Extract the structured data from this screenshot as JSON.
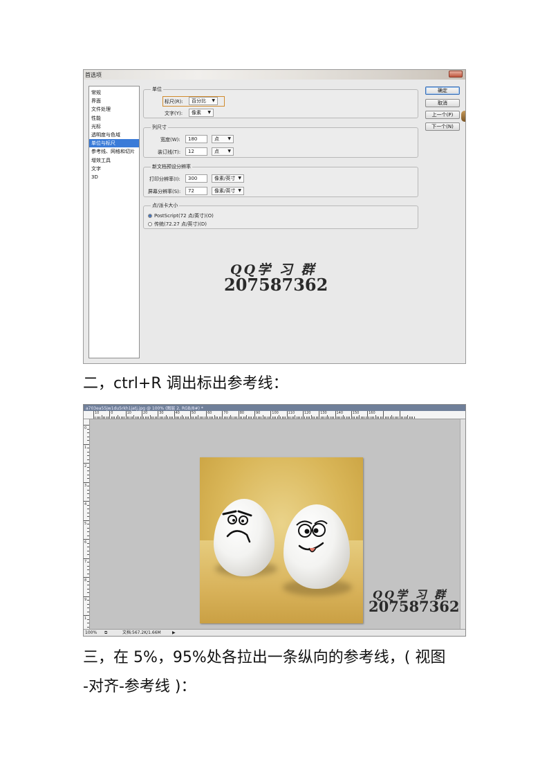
{
  "dialog": {
    "title": "首选项",
    "categories": [
      "常规",
      "界面",
      "文件处理",
      "性能",
      "光标",
      "透明度与色域",
      "单位与标尺",
      "参考线、网格和切片",
      "增效工具",
      "文字",
      "3D"
    ],
    "selected_category": "单位与标尺",
    "units": {
      "group_title": "单位",
      "ruler_label": "标尺(R):",
      "ruler_value": "百分比",
      "type_label": "文字(Y):",
      "type_value": "像素"
    },
    "column": {
      "group_title": "列尺寸",
      "width_label": "宽度(W):",
      "width_value": "180",
      "width_unit": "点",
      "gutter_label": "装订线(T):",
      "gutter_value": "12",
      "gutter_unit": "点"
    },
    "resolution": {
      "group_title": "新文档预设分辨率",
      "print_label": "打印分辨率(I):",
      "print_value": "300",
      "print_unit": "像素/英寸",
      "screen_label": "屏幕分辨率(S):",
      "screen_value": "72",
      "screen_unit": "像素/英寸"
    },
    "point_size": {
      "group_title": "点/派卡大小",
      "option_postscript": "PostScript(72 点/英寸)(O)",
      "option_traditional": "传统(72.27 点/英寸)(D)",
      "selected": "PostScript(72 点/英寸)(O)"
    },
    "buttons": {
      "ok": "确定",
      "cancel": "取消",
      "prev": "上一个(P)",
      "next": "下一个(N)"
    }
  },
  "watermark": {
    "line1": "QQ学 习 群",
    "line2": "207587362"
  },
  "captions": {
    "step2": "二，ctrl+R 调出标出参考线：",
    "step3_line1": "三，在 5%，95%处各拉出一条纵向的参考线，( 视图",
    "step3_line2": "-对齐-参考线 )："
  },
  "photoshop": {
    "tab_title": "a703ea55jw1du5rkh1jatj.jpg @ 100% (图层 2, RGB/8#) *",
    "ruler_labels": [
      "10",
      "0",
      "10",
      "20",
      "30",
      "40",
      "50",
      "60",
      "70",
      "80",
      "90",
      "100",
      "110",
      "120",
      "130",
      "140",
      "150",
      "160"
    ],
    "vruler_labels": [
      "0",
      "1",
      "2",
      "3",
      "4",
      "5",
      "6",
      "7",
      "8",
      "9",
      "1"
    ],
    "zoom": "100%",
    "doc_info": "文档:567.2K/1.66M"
  }
}
